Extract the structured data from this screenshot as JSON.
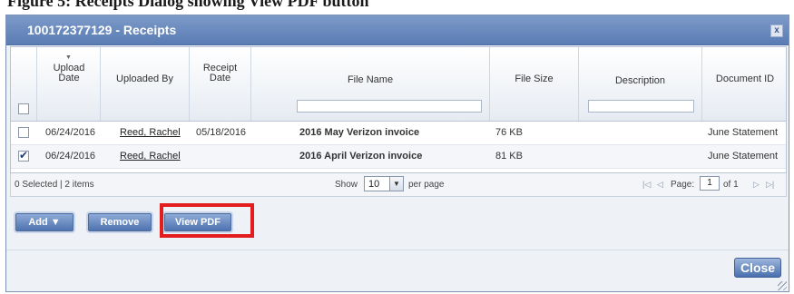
{
  "caption": "Figure 5: Receipts Dialog showing View PDF button",
  "dialog": {
    "title": "100172377129 - Receipts",
    "close_x": "x"
  },
  "table": {
    "columns": {
      "upload_date": "Upload Date",
      "uploaded_by": "Uploaded By",
      "receipt_date": "Receipt Date",
      "file_name": "File Name",
      "file_size": "File Size",
      "description": "Description",
      "document_id": "Document ID"
    },
    "sort_indicator": "▼",
    "rows": [
      {
        "checked": false,
        "upload_date": "06/24/2016",
        "uploaded_by": "Reed, Rachel",
        "receipt_date": "05/18/2016",
        "file_name": "2016 May Verizon invoice",
        "file_size": "76 KB",
        "description": "",
        "document_id": "June Statement"
      },
      {
        "checked": true,
        "upload_date": "06/24/2016",
        "uploaded_by": "Reed, Rachel",
        "receipt_date": "",
        "file_name": "2016 April Verizon invoice",
        "file_size": "81 KB",
        "description": "",
        "document_id": "June Statement"
      }
    ]
  },
  "pager": {
    "status": "0 Selected | 2 items",
    "show_label": "Show",
    "per_page_value": "10",
    "per_page_label": "per page",
    "page_label": "Page:",
    "page_value": "1",
    "of_label": "of 1",
    "first_glyph": "|◁",
    "prev_glyph": "◁",
    "next_glyph": "▷",
    "last_glyph": "▷|"
  },
  "buttons": {
    "add": "Add ▼",
    "remove": "Remove",
    "view_pdf": "View PDF",
    "close": "Close"
  },
  "colors": {
    "highlight": "#e31d1d",
    "titlebar": "#5a7cb4"
  }
}
